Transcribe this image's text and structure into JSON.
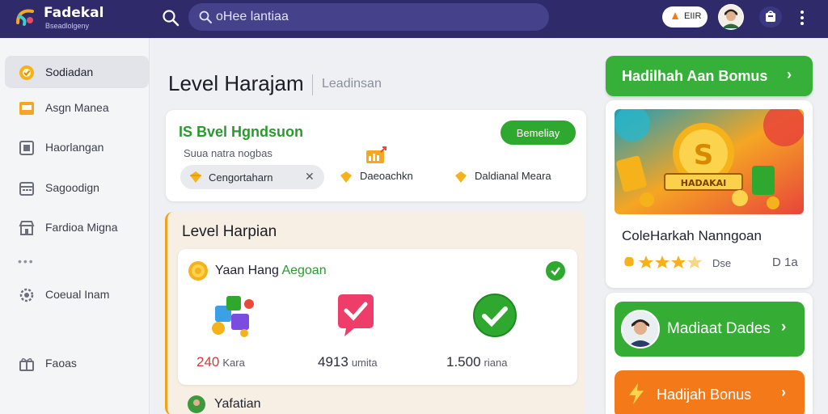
{
  "header": {
    "brand_name": "Fadekal",
    "brand_sub": "Bseadlolgeny",
    "search_placeholder": "oHee lantiaa",
    "pill_label": "EIIR"
  },
  "sidebar": {
    "items": [
      {
        "label": "Sodiadan",
        "icon": "badge-icon",
        "active": true
      },
      {
        "label": "Asgn Manea",
        "icon": "window-icon"
      },
      {
        "label": "Haorlangan",
        "icon": "square-icon"
      },
      {
        "label": "Sagoodign",
        "icon": "calendar-icon"
      },
      {
        "label": "Fardioa Migna",
        "icon": "store-icon"
      },
      {
        "label": "Coeual Inam",
        "icon": "gear-icon"
      },
      {
        "label": "Faoas",
        "icon": "gift-icon"
      }
    ],
    "more": "•••"
  },
  "main": {
    "title": "Level Harajam",
    "subtitle": "Leadinsan",
    "level_card": {
      "title": "IS Bvel Hgndsuon",
      "button": "Bemeliay",
      "caption": "Suua natra nogbas",
      "chip_label": "Cengortaharn",
      "chip_close": "✕",
      "option1": "Daeoachkn",
      "option2": "Daldianal Meara"
    },
    "harian": {
      "title": "Level Harpian",
      "inner_title_a": "Yaan Hang",
      "inner_title_b": "Aegoan",
      "stats": [
        {
          "value": "240",
          "unit": "Kara"
        },
        {
          "value": "4913",
          "unit": "umita"
        },
        {
          "value": "1.500",
          "unit": "riana"
        }
      ],
      "next_label": "Yafatian"
    }
  },
  "right": {
    "bonus_head": "Hadilhah Aan Bomus",
    "promo_banner_text": "HADAKAI",
    "promo_title": "ColeHarkah Nanngoan",
    "rating": "Dse",
    "rating_stars": 3.5,
    "count": "D 1a",
    "daily_label": "Madiaat Dades",
    "bonus_label": "Hadijah Bonus"
  },
  "colors": {
    "topbar": "#2f2b6b",
    "green": "#37b03a",
    "orange": "#f47a19",
    "accent_border": "#f0a21c"
  }
}
